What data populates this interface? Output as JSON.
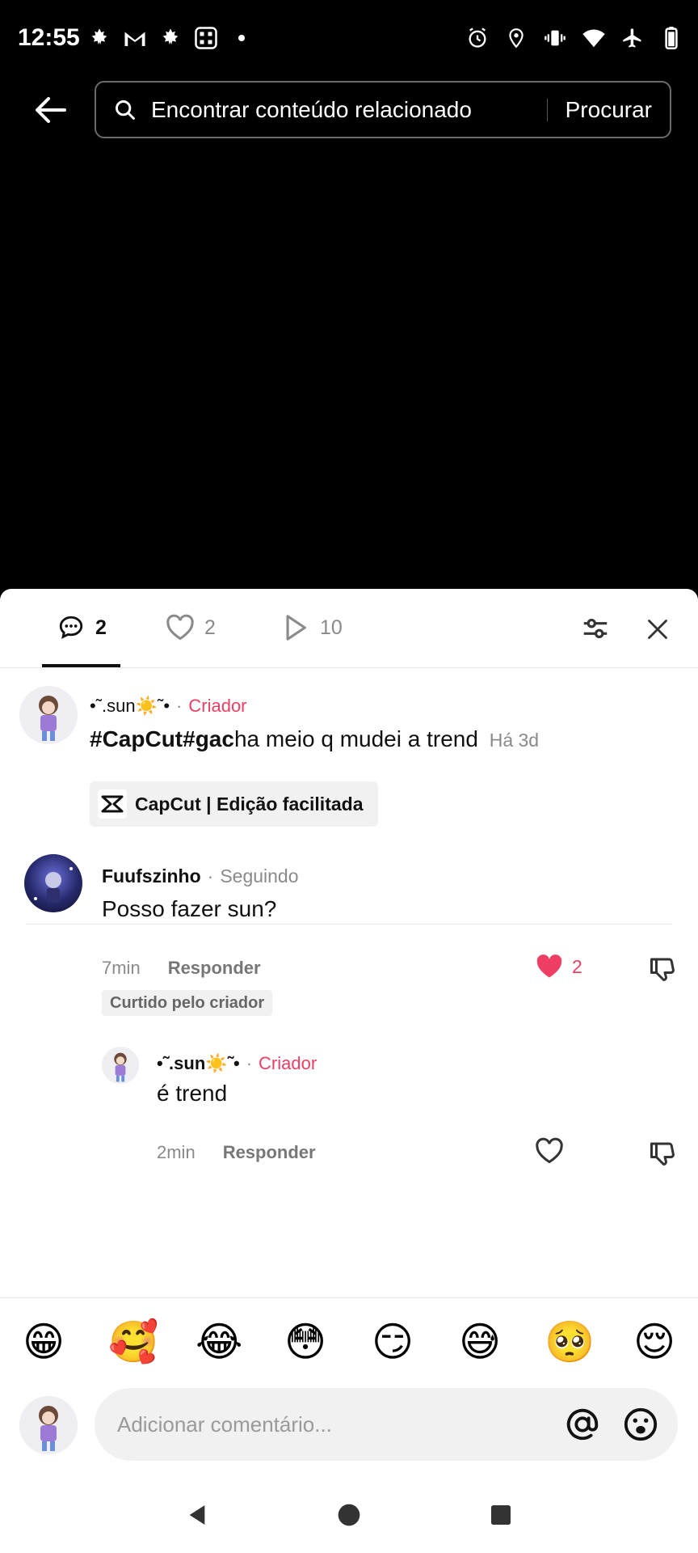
{
  "status_bar": {
    "time": "12:55",
    "left_icons": [
      "maple-leaf-icon",
      "gmail-icon",
      "maple-leaf-icon",
      "qr-icon",
      "dot-icon"
    ],
    "right_icons": [
      "alarm-icon",
      "location-icon",
      "vibrate-icon",
      "wifi-icon",
      "airplane-icon",
      "battery-icon"
    ]
  },
  "header": {
    "search_placeholder": "Encontrar conteúdo relacionado",
    "search_button": "Procurar"
  },
  "tabs": {
    "comments_count": "2",
    "likes_count": "2",
    "plays_count": "10"
  },
  "caption": {
    "author": "•˜.sun☀️˜•",
    "separator": "·",
    "creator_label": "Criador",
    "hashtag1": "#CapCut",
    "hashtag2": "#gac",
    "text": "ha meio q mudei a trend",
    "time": "Há 3d",
    "anchor_label": "CapCut | Edição facilitada"
  },
  "comments": [
    {
      "author": "Fuufszinho",
      "separator": "·",
      "status": "Seguindo",
      "text": "Posso fazer sun?",
      "time": "7min",
      "reply_label": "Responder",
      "likes": "2",
      "liked_by_creator": "Curtido pelo criador"
    },
    {
      "author": "•˜.sun☀️˜•",
      "separator": "·",
      "creator_label": "Criador",
      "text": "é trend",
      "time": "2min",
      "reply_label": "Responder"
    }
  ],
  "emoji_bar": [
    "😁",
    "🥰",
    "😂",
    "😳",
    "😏",
    "😅",
    "🥺",
    "😌"
  ],
  "input": {
    "placeholder": "Adicionar comentário..."
  },
  "colors": {
    "accent_red": "#ee3e63",
    "sheet_bg": "#ffffff",
    "top_bg": "#000000"
  }
}
